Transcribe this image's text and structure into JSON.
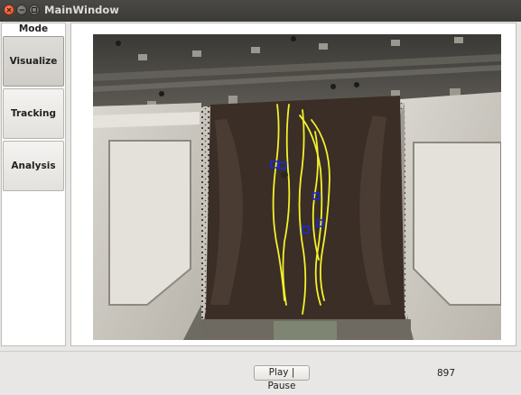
{
  "window": {
    "title": "MainWindow",
    "controls": [
      "close-icon",
      "minimize-icon",
      "maximize-icon"
    ]
  },
  "sidebar": {
    "heading": "Mode",
    "items": [
      {
        "label": "Visualize",
        "active": true
      },
      {
        "label": "Tracking",
        "active": false
      },
      {
        "label": "Analysis",
        "active": false
      }
    ]
  },
  "player": {
    "play_pause_label": "Play | Pause",
    "frame_number": "897"
  },
  "colors": {
    "trajectory": "#f2f22a",
    "marker": "#1b2bd6",
    "titlebar": "#3f3e3b",
    "window_bg": "#e8e7e5"
  }
}
